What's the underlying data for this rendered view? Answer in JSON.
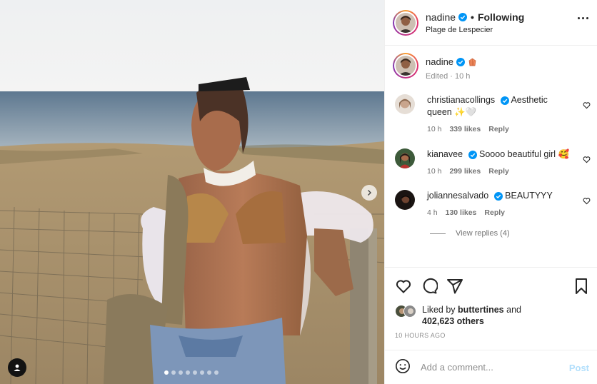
{
  "colors": {
    "accent": "#0095f6",
    "post_disabled": "#b2dffc",
    "verified": "#0095f6"
  },
  "post": {
    "author": "nadine",
    "follow_status": "Following",
    "separator": "•",
    "location": "Plage de Lespecier",
    "carousel": {
      "slides": 8,
      "active": 1
    }
  },
  "caption": {
    "author": "nadine",
    "meta": "Edited · 10 h"
  },
  "comments": [
    {
      "user": "christianacollings",
      "text": "Aesthetic queen ✨🤍",
      "time": "10 h",
      "likes": "339 likes",
      "reply": "Reply"
    },
    {
      "user": "kianavee",
      "text": "Soooo beautiful girl 🥰",
      "time": "10 h",
      "likes": "299 likes",
      "reply": "Reply"
    },
    {
      "user": "joliannesalvado",
      "text": "BEAUTYYY",
      "time": "4 h",
      "likes": "130 likes",
      "reply": "Reply"
    }
  ],
  "view_replies": "View replies (4)",
  "likes": {
    "prefix": "Liked by",
    "user": "buttertines",
    "conj": "and",
    "count": "402,623 others"
  },
  "time_ago": "10 HOURS AGO",
  "composer": {
    "placeholder": "Add a comment...",
    "post_label": "Post"
  },
  "icons": {
    "like": "heart-icon",
    "comment": "comment-icon",
    "share": "paper-plane-icon",
    "save": "bookmark-icon",
    "emoji": "smiley-icon",
    "more": "more-horizontal-icon",
    "next": "chevron-right-icon",
    "tags": "user-tag-icon"
  }
}
